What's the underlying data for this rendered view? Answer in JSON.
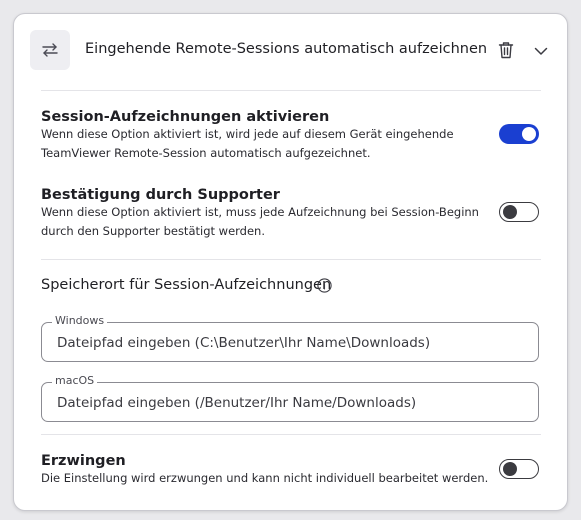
{
  "header": {
    "icon": "swap-arrows-icon",
    "title": "Eingehende Remote-Sessions automatisch aufzeichnen",
    "delete_icon": "trash-icon",
    "expand_icon": "chevron-down-icon"
  },
  "settings": [
    {
      "title": "Session-Aufzeichnungen aktivieren",
      "description": "Wenn diese Option aktiviert ist, wird jede auf diesem Gerät eingehende TeamViewer Remote-Session automatisch aufgezeichnet.",
      "enabled": true
    },
    {
      "title": "Bestätigung durch Supporter",
      "description": "Wenn diese Option aktiviert ist, muss jede Aufzeichnung bei Session-Beginn durch den Supporter bestätigt werden.",
      "enabled": false
    }
  ],
  "storage": {
    "label": "Speicherort für Session-Aufzeichnungen",
    "info_icon": "info-icon",
    "windows": {
      "legend": "Windows",
      "value": "",
      "placeholder": "Dateipfad eingeben (C:\\Benutzer\\Ihr Name\\Downloads)"
    },
    "macos": {
      "legend": "macOS",
      "value": "",
      "placeholder": "Dateipfad eingeben (/Benutzer/Ihr Name/Downloads)"
    }
  },
  "enforce": {
    "title": "Erzwingen",
    "description": "Die Einstellung wird erzwungen und kann nicht individuell bearbeitet werden.",
    "enabled": false
  },
  "colors": {
    "toggle_on": "#1a3fd1",
    "toggle_off_border": "#3b3b40"
  }
}
